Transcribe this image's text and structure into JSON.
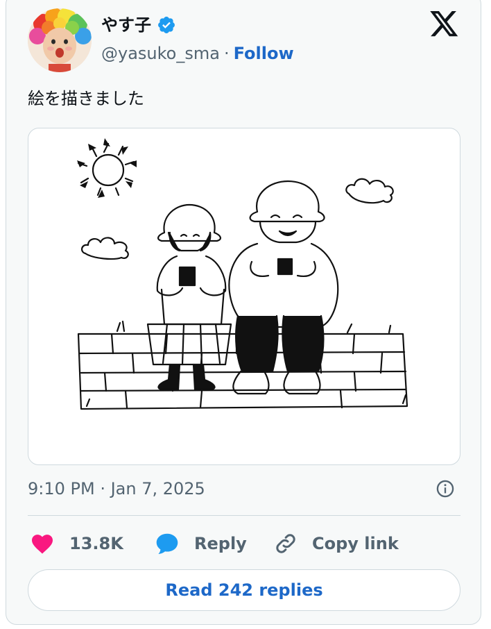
{
  "author": {
    "display_name": "やす子",
    "handle": "@yasuko_sma",
    "separator": "·",
    "follow_label": "Follow",
    "verified_color": "#1d9bf0",
    "avatar_icon": "avatar"
  },
  "brand": {
    "logo_icon": "x-logo-icon"
  },
  "tweet": {
    "text": "絵を描きました",
    "media_icon": "drawing-two-people-eating-rice-balls"
  },
  "meta": {
    "timestamp": "9:10 PM · Jan 7, 2025",
    "info_icon": "info-icon"
  },
  "actions": {
    "like_count": "13.8K",
    "reply_label": "Reply",
    "copy_link_label": "Copy link",
    "like_color": "#f91880",
    "reply_color": "#1d9bf0"
  },
  "read_replies_label": "Read 242 replies",
  "colors": {
    "link": "#1d68c8",
    "text": "#0f1419",
    "secondary": "#536471",
    "border": "#cfd9de"
  }
}
